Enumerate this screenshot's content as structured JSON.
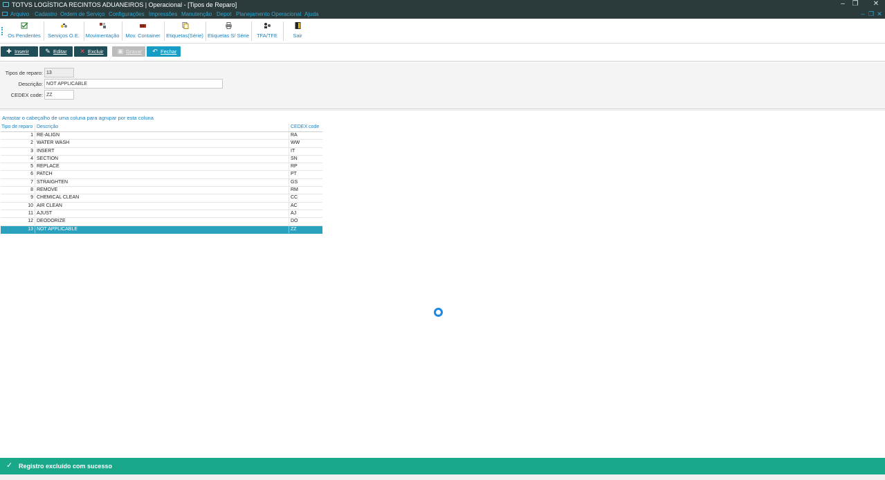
{
  "window": {
    "title": "TOTVS LOGÍSTICA RECINTOS ADUANEIROS | Operacional - [Tipos de Reparo]",
    "minimize": "–",
    "restore": "❐",
    "close": "✕"
  },
  "menu": {
    "items": [
      "Arquivo",
      "Cadastro",
      "Ordem de Serviço",
      "Configurações",
      "Impressões",
      "Manutenção",
      "Depot",
      "Planejamento Operacional",
      "Ajuda"
    ],
    "mdi_minimize": "–",
    "mdi_restore": "❐",
    "mdi_close": "✕"
  },
  "shortcuts": [
    {
      "label": "Os Pendentes",
      "icon": "checklist-icon"
    },
    {
      "label": "Serviços O.E.",
      "icon": "tools-icon"
    },
    {
      "label": "Movimentação",
      "icon": "movement-icon"
    },
    {
      "label": "Mov. Container",
      "icon": "container-icon"
    },
    {
      "label": "Etiquetas(Série)",
      "icon": "labels-icon"
    },
    {
      "label": "Etiquetas S/ Série",
      "icon": "printer-icon"
    },
    {
      "label": "TFA/TFE",
      "icon": "people-icon"
    },
    {
      "label": "Sair",
      "icon": "exit-door-icon"
    }
  ],
  "actions": {
    "insert": "Inserir",
    "edit": "Editar",
    "delete": "Excluir",
    "save": "Gravar",
    "close": "Fechar"
  },
  "form": {
    "tipo_label": "Tipos de reparo:",
    "tipo_value": "13",
    "descricao_label": "Descrição:",
    "descricao_value": "NOT APPLICABLE",
    "cedex_label": "CEDEX code:",
    "cedex_value": "ZZ"
  },
  "grid": {
    "group_hint": "Arrastar o cabeçalho de uma coluna para agrupar por esta coluna",
    "columns": [
      "Tipo de reparo",
      "Descrição",
      "CEDEX code"
    ],
    "rows": [
      {
        "id": "1",
        "descricao": "RE-ALIGN",
        "cedex": "RA"
      },
      {
        "id": "2",
        "descricao": "WATER WASH",
        "cedex": "WW"
      },
      {
        "id": "3",
        "descricao": "INSERT",
        "cedex": "IT"
      },
      {
        "id": "4",
        "descricao": "SECTION",
        "cedex": "SN"
      },
      {
        "id": "5",
        "descricao": "REPLACE",
        "cedex": "RP"
      },
      {
        "id": "6",
        "descricao": "PATCH",
        "cedex": "PT"
      },
      {
        "id": "7",
        "descricao": "STRAIGHTEN",
        "cedex": "GS"
      },
      {
        "id": "8",
        "descricao": "REMOVE",
        "cedex": "RM"
      },
      {
        "id": "9",
        "descricao": "CHEMICAL CLEAN",
        "cedex": "CC"
      },
      {
        "id": "10",
        "descricao": "AIR CLEAN",
        "cedex": "AC"
      },
      {
        "id": "11",
        "descricao": "AJUST",
        "cedex": "AJ"
      },
      {
        "id": "12",
        "descricao": "DEODORIZE",
        "cedex": "DO"
      },
      {
        "id": "13",
        "descricao": "NOT APPLICABLE",
        "cedex": "ZZ"
      }
    ],
    "selected_index": 12
  },
  "toast": {
    "check": "✓",
    "message": "Registro excluído com sucesso"
  },
  "colors": {
    "titlebar": "#2b3b3c",
    "menu_text": "#2fa6d0",
    "selected_row": "#2aa1bf",
    "toast": "#19a98a",
    "spinner": "#1e88e5"
  }
}
